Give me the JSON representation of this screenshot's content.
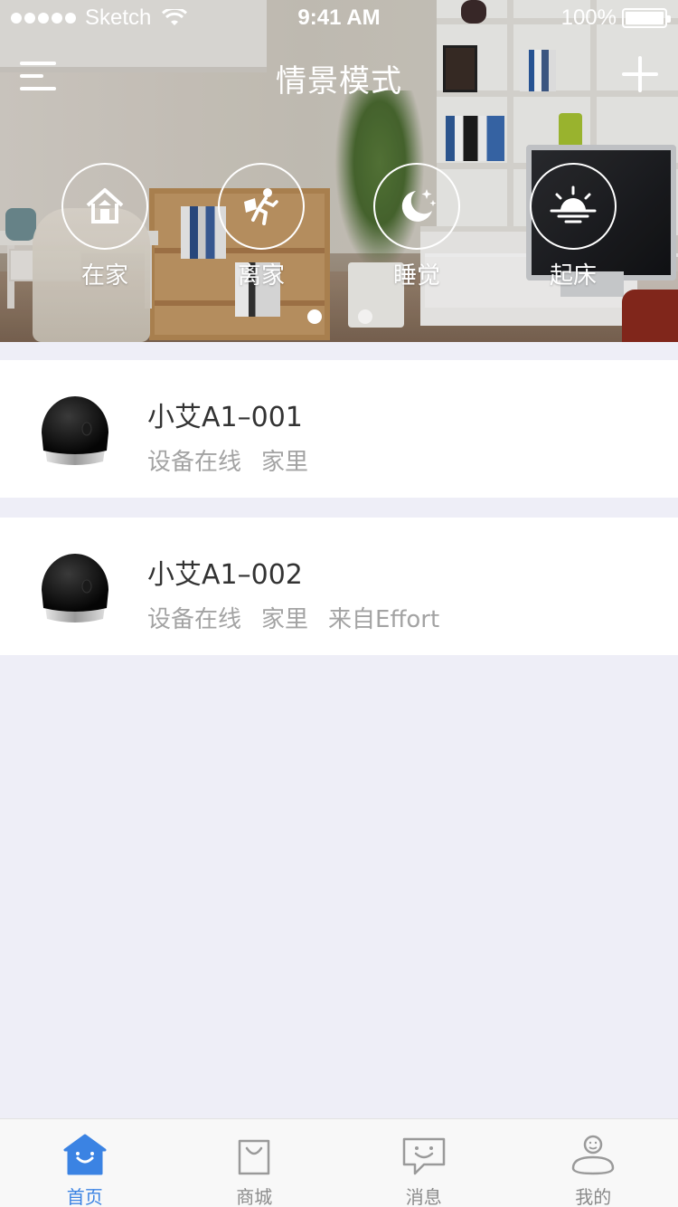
{
  "status_bar": {
    "carrier": "Sketch",
    "time": "9:41 AM",
    "battery": "100%"
  },
  "header": {
    "title": "情景模式",
    "menu_icon": "menu-icon",
    "add_icon": "plus-icon"
  },
  "scenes": [
    {
      "label": "在家",
      "icon": "home-icon"
    },
    {
      "label": "离家",
      "icon": "leave-home-icon"
    },
    {
      "label": "睡觉",
      "icon": "moon-icon"
    },
    {
      "label": "起床",
      "icon": "sunrise-icon"
    }
  ],
  "pager": {
    "active_index": 0,
    "count": 2
  },
  "devices": [
    {
      "name": "小艾A1–001",
      "status": "设备在线",
      "location": "家里",
      "source": ""
    },
    {
      "name": "小艾A1–002",
      "status": "设备在线",
      "location": "家里",
      "source": "来自Effort"
    }
  ],
  "tabbar": {
    "tabs": [
      {
        "label": "首页",
        "icon": "home-tab-icon",
        "active": true
      },
      {
        "label": "商城",
        "icon": "shopping-bag-icon",
        "active": false
      },
      {
        "label": "消息",
        "icon": "message-icon",
        "active": false
      },
      {
        "label": "我的",
        "icon": "profile-icon",
        "active": false
      }
    ]
  },
  "colors": {
    "accent": "#3b83e3",
    "background": "#eeeef7",
    "secondary_text": "#a3a3a3"
  }
}
